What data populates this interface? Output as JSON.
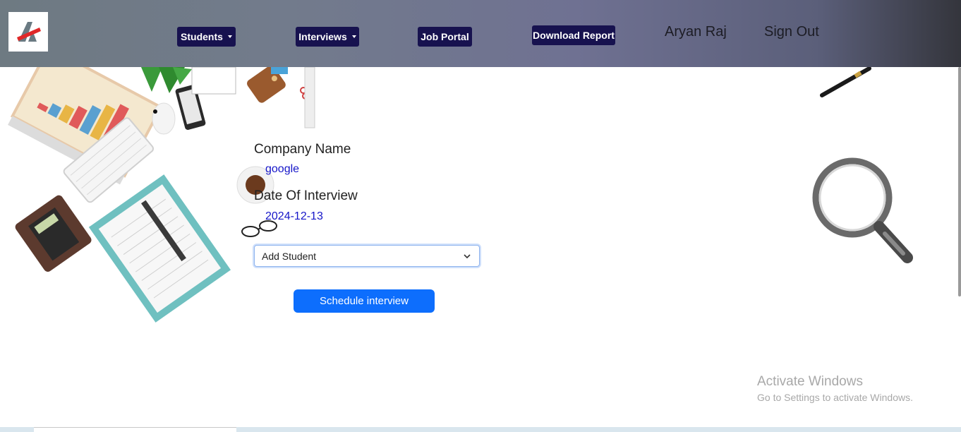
{
  "header": {
    "nav": {
      "students": "Students",
      "interviews": "Interviews",
      "job_portal": "Job Portal",
      "download_report": "Download Report"
    },
    "user_name": "Aryan Raj",
    "sign_out": "Sign Out"
  },
  "form": {
    "company_label": "Company Name",
    "company_value": "google",
    "date_label": "Date Of Interview",
    "date_value": "2024-12-13",
    "select_value": "Add Student",
    "submit_label": "Schedule interview"
  },
  "watermark": {
    "title": "Activate Windows",
    "subtitle": "Go to Settings to activate Windows."
  },
  "colors": {
    "nav_button_bg": "#17124f",
    "primary_button": "#0d6efd",
    "value_text": "#1515c8"
  },
  "icons": [
    "logo-icon",
    "chevron-down-icon",
    "caret-down-icon",
    "desk-illustration",
    "pen-illustration",
    "magnifier-illustration"
  ]
}
